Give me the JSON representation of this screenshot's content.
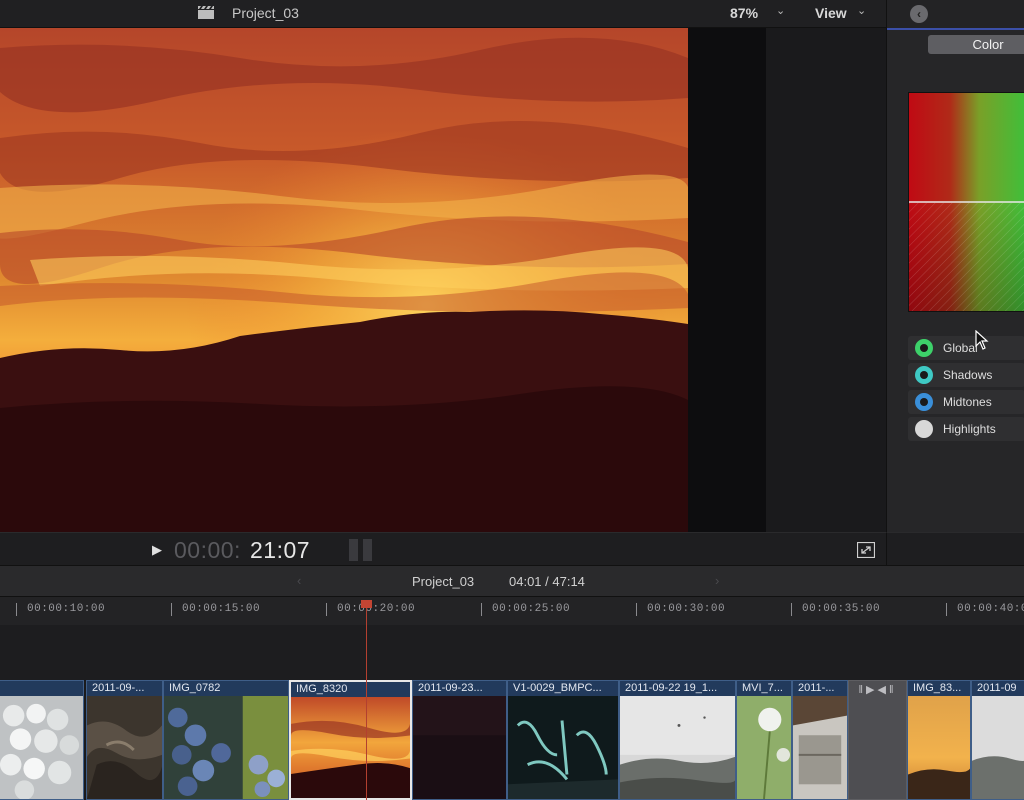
{
  "topbar": {
    "project_title": "Project_03",
    "zoom": "87%",
    "view_label": "View"
  },
  "transport": {
    "timecode_dim": "00:00:",
    "timecode_bright": "21:07"
  },
  "inspector": {
    "tab_label": "Color",
    "tones": [
      {
        "label": "Global",
        "color": "#3dd16a"
      },
      {
        "label": "Shadows",
        "color": "#3fc9c4"
      },
      {
        "label": "Midtones",
        "color": "#3a8fd9"
      },
      {
        "label": "Highlights",
        "color": "#d8d8d8"
      }
    ]
  },
  "timeline": {
    "project_name": "Project_03",
    "duration": "04:01 / 47:14",
    "ruler_labels": [
      "00:00:10:00",
      "00:00:15:00",
      "00:00:20:00",
      "00:00:25:00",
      "00:00:30:00",
      "00:00:35:00",
      "00:00:40:0"
    ],
    "clips": [
      {
        "label": ""
      },
      {
        "label": "2011-09-..."
      },
      {
        "label": "IMG_0782"
      },
      {
        "label": "IMG_8320"
      },
      {
        "label": "2011-09-23..."
      },
      {
        "label": "V1-0029_BMPC..."
      },
      {
        "label": "2011-09-22 19_1..."
      },
      {
        "label": "MVI_7..."
      },
      {
        "label": "2011-..."
      },
      {
        "label": "IMG_83..."
      },
      {
        "label": "2011-09"
      }
    ]
  },
  "colors": {
    "accent": "#3b4fa8",
    "clip_blue": "#223a5c",
    "playhead": "#c44533"
  }
}
